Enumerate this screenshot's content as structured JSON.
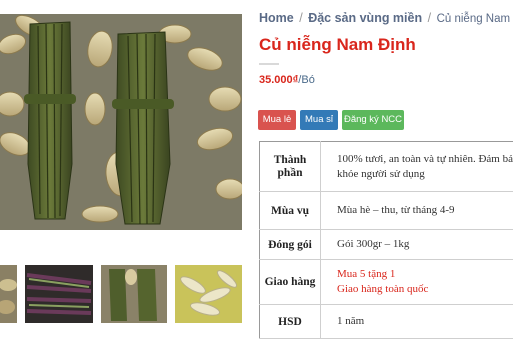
{
  "breadcrumb": {
    "home": "Home",
    "category": "Đặc sản vùng miền",
    "current": "Củ niễng Nam Định",
    "separator": "/"
  },
  "product": {
    "title": "Củ niễng Nam Định",
    "price": "35.000₫",
    "unit": "/Bó"
  },
  "buttons": {
    "retail": "Mua lẻ",
    "wholesale": "Mua sỉ",
    "supplier": "Đăng ký NCC"
  },
  "info_table": [
    {
      "label": "Thành phần",
      "lines": [
        "100% tươi, an toàn và tự nhiên. Đảm bả",
        "khỏe người sử dụng"
      ],
      "highlight": false
    },
    {
      "label": "Mùa vụ",
      "lines": [
        "Mùa hè – thu, từ tháng 4-9"
      ],
      "highlight": false
    },
    {
      "label": "Đóng gói",
      "lines": [
        "Gói  300gr – 1kg"
      ],
      "highlight": false
    },
    {
      "label": "Giao hàng",
      "lines": [
        "Mua 5 tặng 1",
        "Giao hàng toàn quốc"
      ],
      "highlight": true
    },
    {
      "label": "HSD",
      "lines": [
        "1 năm"
      ],
      "highlight": false
    }
  ],
  "colors": {
    "title_red": "#d9261c",
    "btn_retail": "#d9534f",
    "btn_wholesale": "#337ab7",
    "btn_supplier": "#5cb85c"
  }
}
